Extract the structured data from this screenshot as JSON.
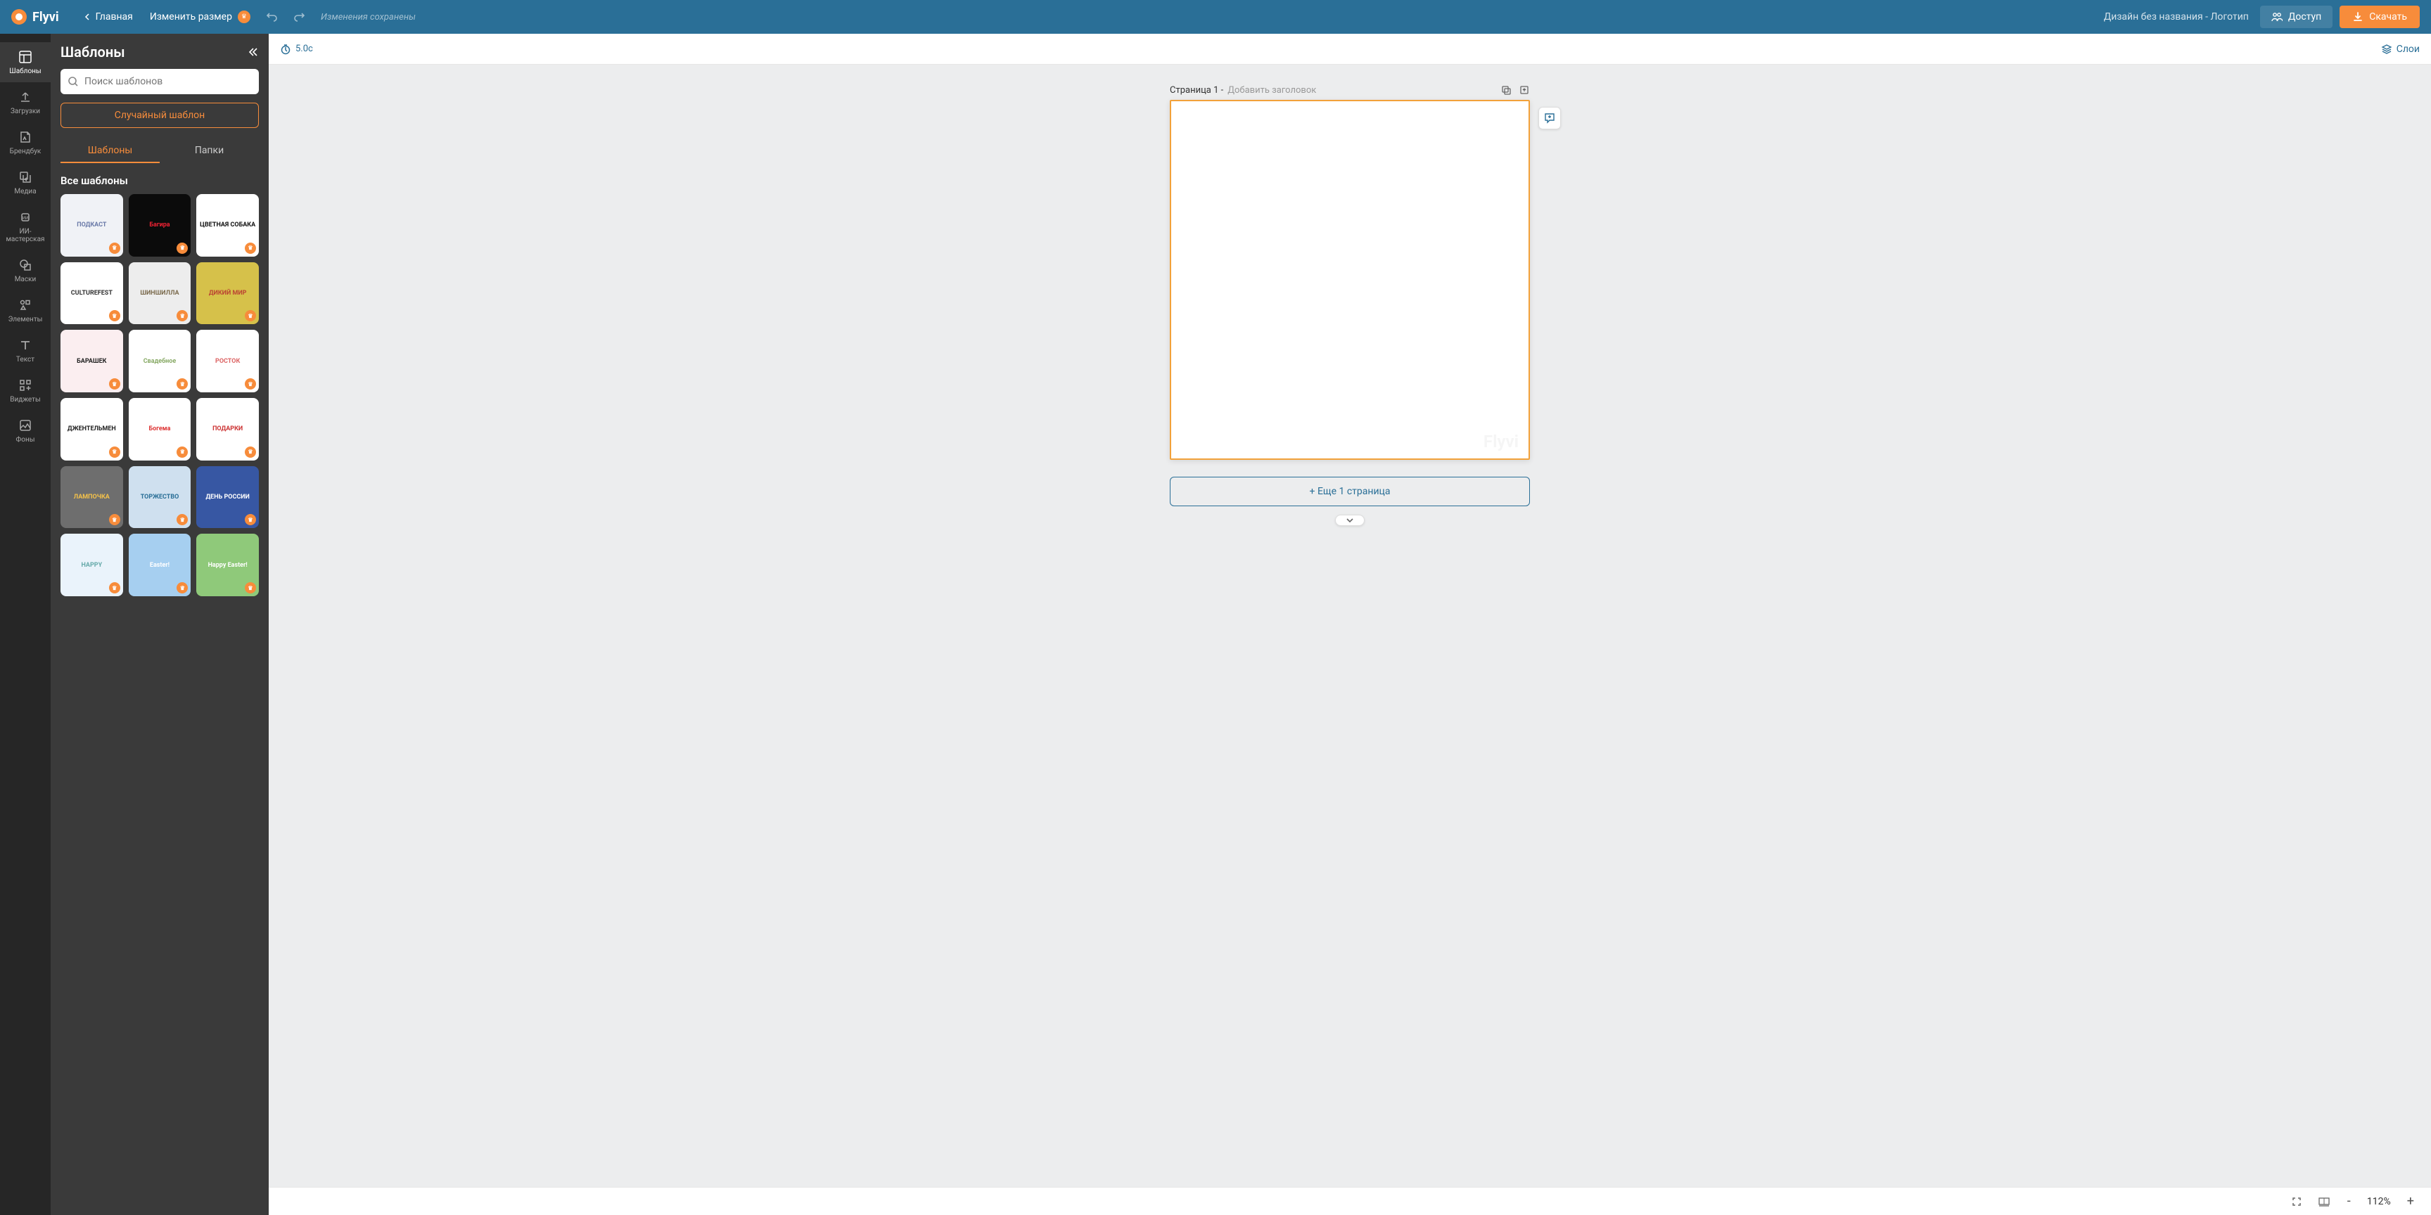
{
  "brand": {
    "name": "Flyvi"
  },
  "header": {
    "home": "Главная",
    "resize": "Изменить размер",
    "saved": "Изменения сохранены",
    "design_name": "Дизайн без названия - Логотип",
    "access": "Доступ",
    "download": "Скачать"
  },
  "nav": {
    "templates": "Шаблоны",
    "uploads": "Загрузки",
    "brandbook": "Брендбук",
    "media": "Медиа",
    "ai": "ИИ-мастерская",
    "masks": "Маски",
    "elements": "Элементы",
    "text": "Текст",
    "widgets": "Виджеты",
    "backgrounds": "Фоны"
  },
  "panel": {
    "title": "Шаблоны",
    "search_placeholder": "Поиск шаблонов",
    "random": "Случайный шаблон",
    "tab_templates": "Шаблоны",
    "tab_folders": "Папки",
    "section_all": "Все шаблоны"
  },
  "templates": [
    {
      "label": "ПОДКАСТ",
      "bg": "#f0f2f6",
      "fg": "#6a7aa8"
    },
    {
      "label": "Багира",
      "bg": "#0b0b0b",
      "fg": "#e23"
    },
    {
      "label": "ЦВЕТНАЯ СОБАКА",
      "bg": "#ffffff",
      "fg": "#111"
    },
    {
      "label": "CULTUREFEST",
      "bg": "#ffffff",
      "fg": "#333"
    },
    {
      "label": "ШИНШИЛЛА",
      "bg": "#ededed",
      "fg": "#7a6a4c"
    },
    {
      "label": "ДИКИЙ МИР",
      "bg": "#d6c14a",
      "fg": "#b43"
    },
    {
      "label": "БАРАШЕК",
      "bg": "#fbeef0",
      "fg": "#222"
    },
    {
      "label": "Свадебное",
      "bg": "#fff",
      "fg": "#8a6"
    },
    {
      "label": "РОСТОК",
      "bg": "#fff",
      "fg": "#d66"
    },
    {
      "label": "ДЖЕНТЕЛЬМЕН",
      "bg": "#fff",
      "fg": "#222"
    },
    {
      "label": "Богема",
      "bg": "#fff",
      "fg": "#d33"
    },
    {
      "label": "ПОДАРКИ",
      "bg": "#fff",
      "fg": "#c33"
    },
    {
      "label": "ЛАМПОЧКА",
      "bg": "#6e6e6e",
      "fg": "#f5c24a"
    },
    {
      "label": "ТОРЖЕСТВО",
      "bg": "#cfe0ef",
      "fg": "#2a6f97"
    },
    {
      "label": "ДЕНЬ РОССИИ",
      "bg": "#3757a3",
      "fg": "#fff"
    },
    {
      "label": "HAPPY",
      "bg": "#eaf3fb",
      "fg": "#6aa"
    },
    {
      "label": "Easter!",
      "bg": "#a6cff0",
      "fg": "#fff"
    },
    {
      "label": "Happy Easter!",
      "bg": "#8fc97a",
      "fg": "#fff"
    }
  ],
  "canvas": {
    "timer": "5.0с",
    "layers": "Слои",
    "page_label": "Страница 1 -",
    "page_title_placeholder": "Добавить заголовок",
    "add_page": "+ Еще 1 страница",
    "watermark": "Flyvi"
  },
  "zoom": {
    "value": "112%"
  }
}
